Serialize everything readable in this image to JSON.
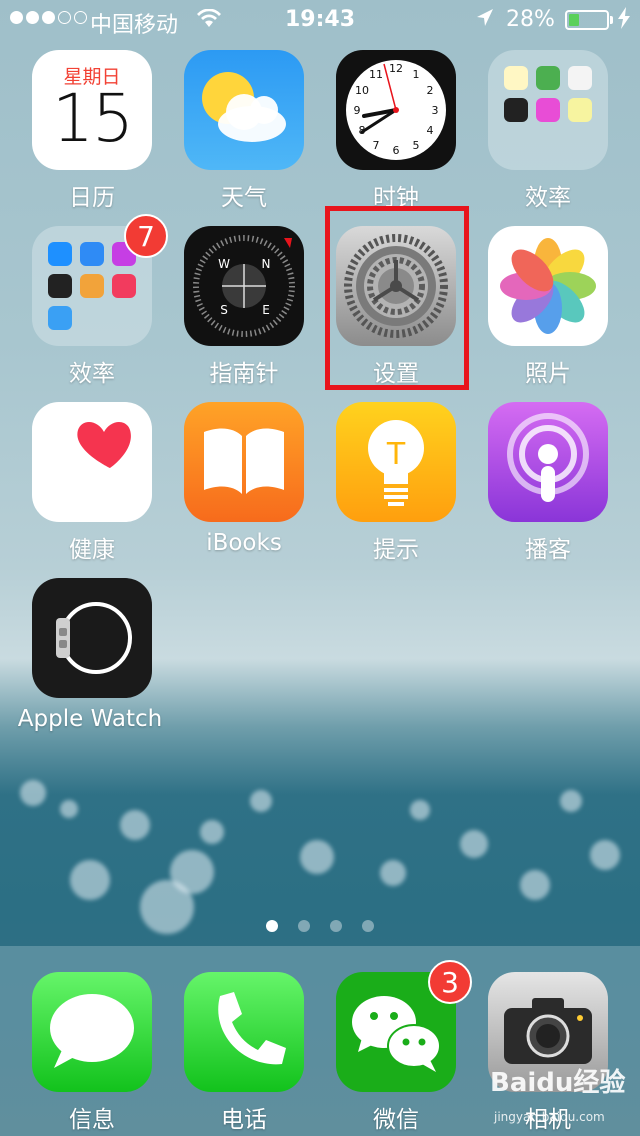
{
  "status_bar": {
    "carrier": "中国移动",
    "time": "19:43",
    "battery_percent": "28%",
    "battery_level": 0.28,
    "signal_bars": 3
  },
  "apps": {
    "calendar": {
      "label": "日历",
      "weekday": "星期日",
      "day": "15"
    },
    "weather": {
      "label": "天气"
    },
    "clock": {
      "label": "时钟"
    },
    "folder1": {
      "label": "效率"
    },
    "folder2": {
      "label": "效率",
      "badge": "7"
    },
    "compass": {
      "label": "指南针"
    },
    "settings": {
      "label": "设置"
    },
    "photos": {
      "label": "照片"
    },
    "health": {
      "label": "健康"
    },
    "ibooks": {
      "label": "iBooks"
    },
    "tips": {
      "label": "提示"
    },
    "podcasts": {
      "label": "播客"
    },
    "watch": {
      "label": "Apple Watch"
    }
  },
  "page_indicator": {
    "count": 4,
    "active": 1
  },
  "dock": {
    "messages": {
      "label": "信息"
    },
    "phone": {
      "label": "电话"
    },
    "wechat": {
      "label": "微信",
      "badge": "3"
    },
    "camera": {
      "label": "相机"
    }
  },
  "watermark": {
    "text": "Baidu经验",
    "sub": "jingyan.baidu.com"
  },
  "colors": {
    "highlight": "#e8141c",
    "badge": "#f23b34"
  }
}
